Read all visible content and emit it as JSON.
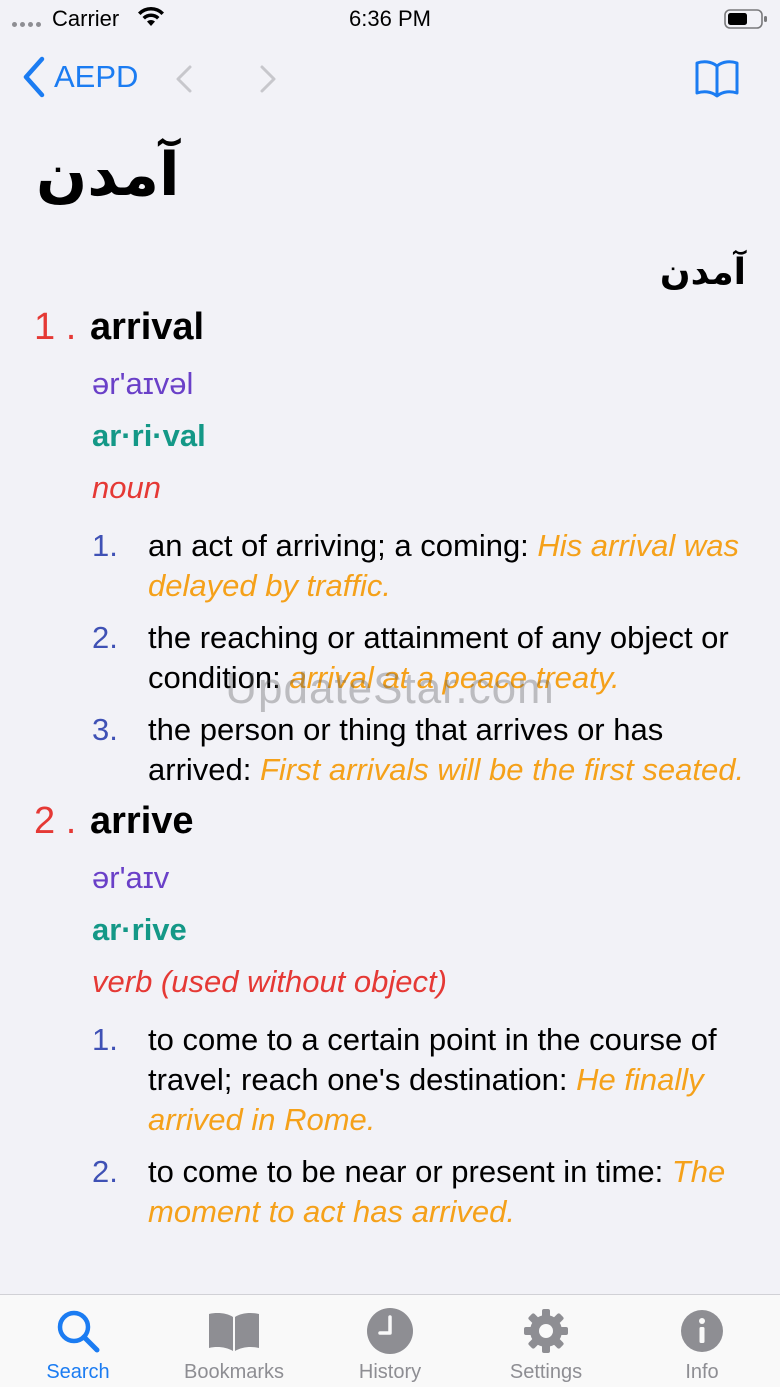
{
  "status_bar": {
    "carrier": "Carrier",
    "time": "6:36 PM"
  },
  "nav": {
    "back_label": "AEPD"
  },
  "headword": "آمدن",
  "entry_persian": "آمدن",
  "senses": [
    {
      "num": "1 .",
      "word": "arrival",
      "pron": "ər'aɪvəl",
      "syll": "ar·ri·val",
      "pos": "noun",
      "defs": [
        {
          "num": "1.",
          "text": "an act of arriving; a coming: ",
          "example": "His arrival was delayed by traffic."
        },
        {
          "num": "2.",
          "text": "the reaching or attainment of any object or condition: ",
          "example": "arrival at a peace treaty."
        },
        {
          "num": "3.",
          "text": "the person or thing that arrives or has arrived: ",
          "example": "First arrivals will be the first seated."
        }
      ]
    },
    {
      "num": "2 .",
      "word": "arrive",
      "pron": "ər'aɪv",
      "syll": "ar·rive",
      "pos": "verb (used without object)",
      "defs": [
        {
          "num": "1.",
          "text": "to come to a certain point in the course of travel; reach one's destination: ",
          "example": "He finally arrived in Rome."
        },
        {
          "num": "2.",
          "text": "to come to be near or present in time: ",
          "example": "The moment to act has arrived."
        }
      ]
    }
  ],
  "watermark": "UpdateStar.com",
  "tabs": [
    {
      "label": "Search",
      "icon": "search-icon",
      "active": true
    },
    {
      "label": "Bookmarks",
      "icon": "book-icon"
    },
    {
      "label": "History",
      "icon": "clock-icon"
    },
    {
      "label": "Settings",
      "icon": "gear-icon"
    },
    {
      "label": "Info",
      "icon": "info-icon"
    }
  ],
  "colors": {
    "accent": "#1b7cf2",
    "sense_num": "#e53935",
    "pron": "#6a40c8",
    "syll": "#149887",
    "example": "#f5a11a",
    "def_num": "#3f51b5"
  }
}
